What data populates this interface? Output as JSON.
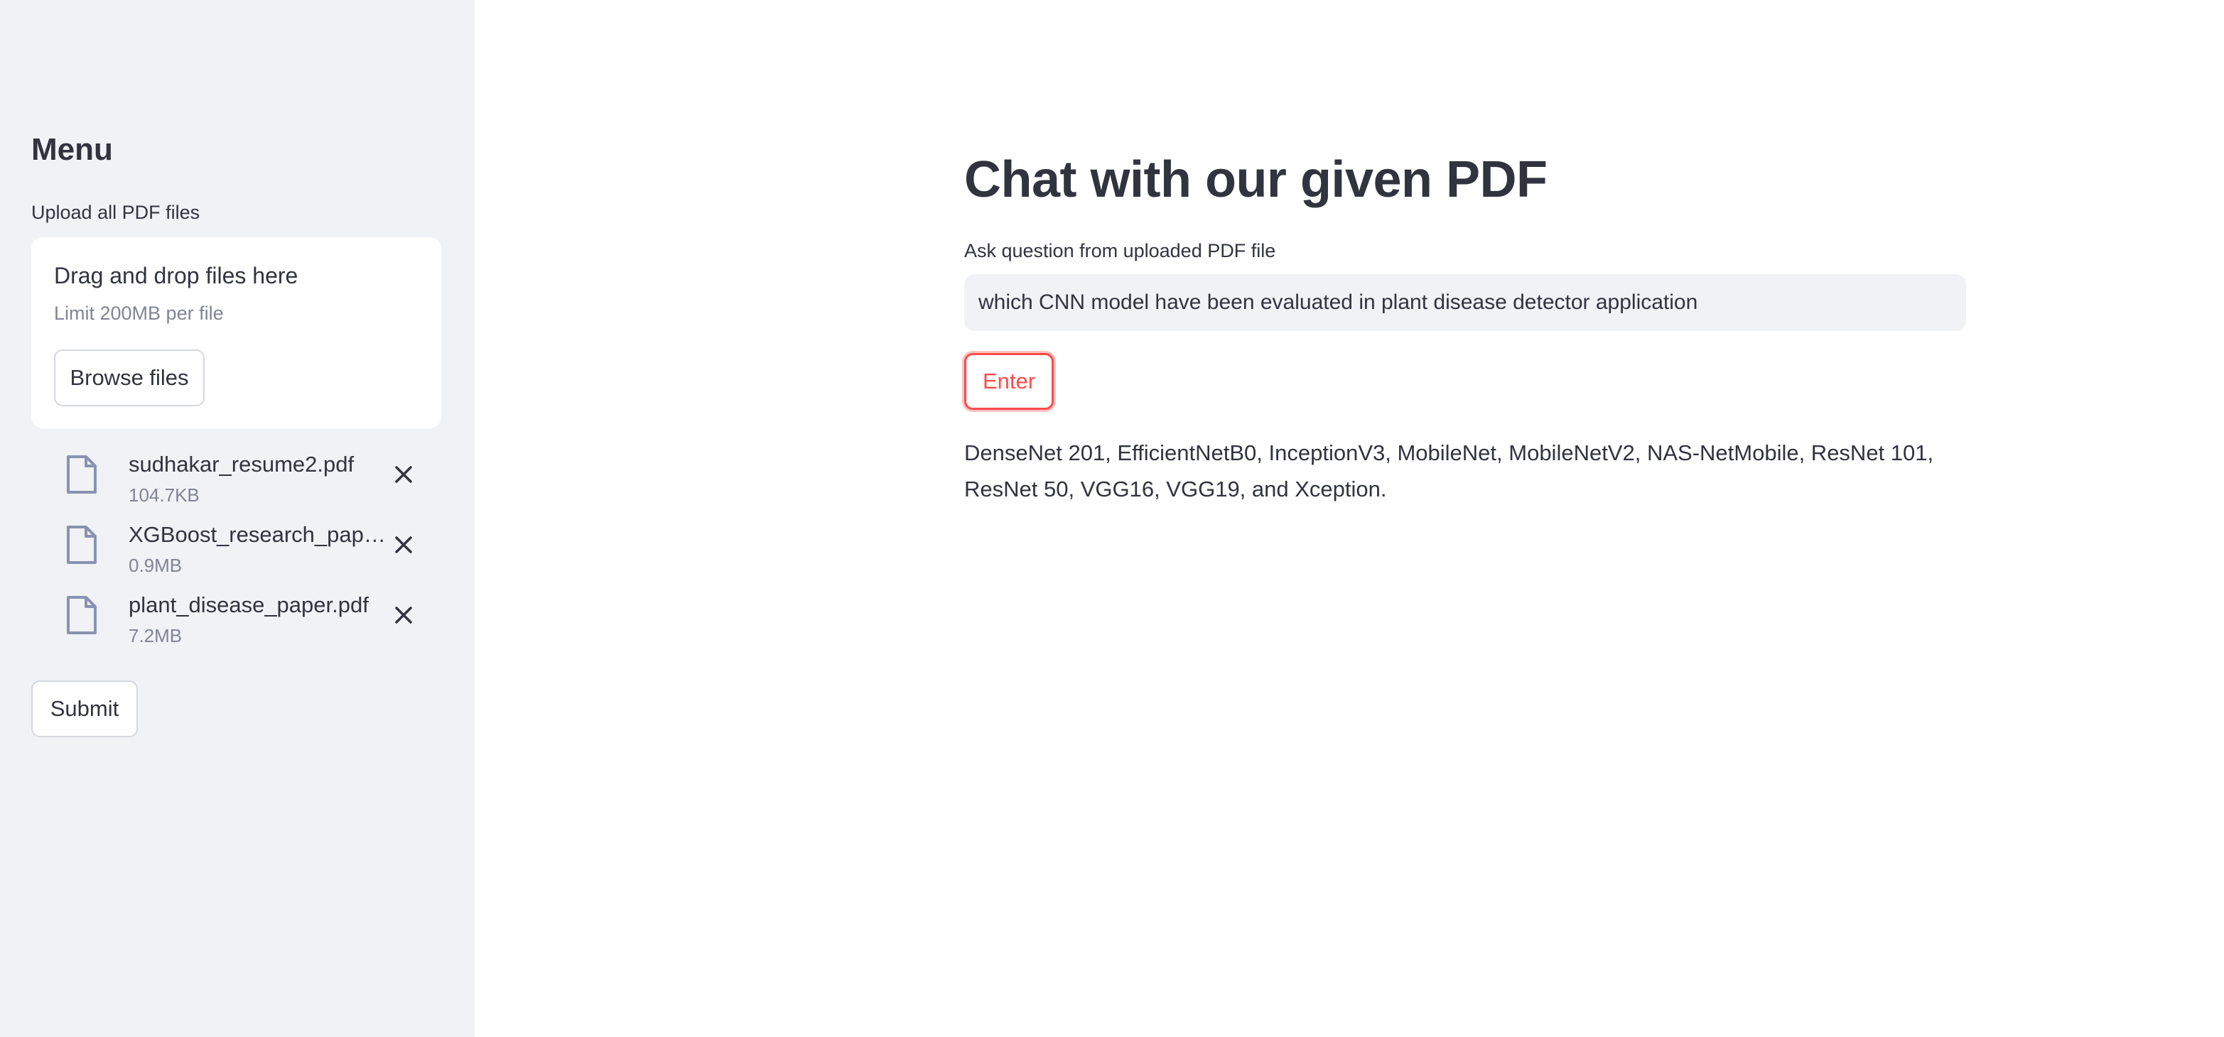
{
  "sidebar": {
    "title": "Menu",
    "upload_label": "Upload all PDF files",
    "dropzone": {
      "title": "Drag and drop files here",
      "limit": "Limit 200MB per file",
      "browse_label": "Browse files"
    },
    "files": [
      {
        "name": "sudhakar_resume2.pdf",
        "size": "104.7KB"
      },
      {
        "name": "XGBoost_research_paper…",
        "size": "0.9MB"
      },
      {
        "name": "plant_disease_paper.pdf",
        "size": "7.2MB"
      }
    ],
    "submit_label": "Submit"
  },
  "main": {
    "title": "Chat with our given PDF",
    "question_label": "Ask question from uploaded PDF file",
    "question_value": "which CNN model have been evaluated in plant disease detector application",
    "enter_label": "Enter",
    "answer": "DenseNet 201, EfficientNetB0, InceptionV3, MobileNet, MobileNetV2, NAS-NetMobile, ResNet 101, ResNet 50, VGG16, VGG19, and Xception."
  },
  "icons": {
    "file": "file-icon",
    "remove": "close-icon"
  },
  "colors": {
    "sidebar_bg": "#f0f2f6",
    "accent": "#ff4b4b",
    "text": "#31333f",
    "muted": "#808495"
  }
}
